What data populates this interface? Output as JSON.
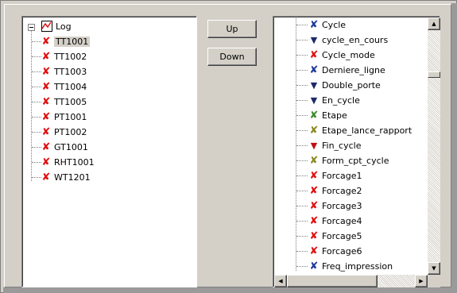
{
  "colors": {
    "x_red": "#e01010",
    "x_blue": "#1e3a9a",
    "x_green": "#3a8a2a",
    "x_olive": "#8a8a20",
    "tick_navy": "#1e2a6a",
    "tick_red": "#c01010"
  },
  "tree": {
    "root": {
      "label": "Log",
      "icon": "log-tree-icon"
    },
    "items": [
      {
        "label": "TT1001",
        "icon": "red-x-icon",
        "selected": true
      },
      {
        "label": "TT1002",
        "icon": "red-x-icon"
      },
      {
        "label": "TT1003",
        "icon": "red-x-icon"
      },
      {
        "label": "TT1004",
        "icon": "red-x-icon"
      },
      {
        "label": "TT1005",
        "icon": "red-x-icon"
      },
      {
        "label": "PT1001",
        "icon": "red-x-icon"
      },
      {
        "label": "PT1002",
        "icon": "red-x-icon"
      },
      {
        "label": "GT1001",
        "icon": "red-x-icon"
      },
      {
        "label": "RHT1001",
        "icon": "red-x-icon"
      },
      {
        "label": "WT1201",
        "icon": "red-x-icon"
      }
    ]
  },
  "buttons": {
    "up": "Up",
    "down": "Down"
  },
  "variables": {
    "items": [
      {
        "label": "Cycle",
        "icon": "blue-x-icon"
      },
      {
        "label": "cycle_en_cours",
        "icon": "navy-tick-icon"
      },
      {
        "label": "Cycle_mode",
        "icon": "red-x-icon"
      },
      {
        "label": "Derniere_ligne",
        "icon": "blue-x-icon"
      },
      {
        "label": "Double_porte",
        "icon": "navy-tick-icon"
      },
      {
        "label": "En_cycle",
        "icon": "navy-tick-icon"
      },
      {
        "label": "Etape",
        "icon": "green-x-icon"
      },
      {
        "label": "Etape_lance_rapport",
        "icon": "olive-x-icon"
      },
      {
        "label": "Fin_cycle",
        "icon": "red-tick-icon"
      },
      {
        "label": "Form_cpt_cycle",
        "icon": "olive-x-icon"
      },
      {
        "label": "Forcage1",
        "icon": "red-x-icon"
      },
      {
        "label": "Forcage2",
        "icon": "red-x-icon"
      },
      {
        "label": "Forcage3",
        "icon": "red-x-icon"
      },
      {
        "label": "Forcage4",
        "icon": "red-x-icon"
      },
      {
        "label": "Forcage5",
        "icon": "red-x-icon"
      },
      {
        "label": "Forcage6",
        "icon": "red-x-icon"
      },
      {
        "label": "Freq_impression",
        "icon": "blue-x-icon"
      }
    ]
  },
  "scrollbar": {
    "vertical_position": 0.09,
    "horizontal_position": 0.0
  }
}
